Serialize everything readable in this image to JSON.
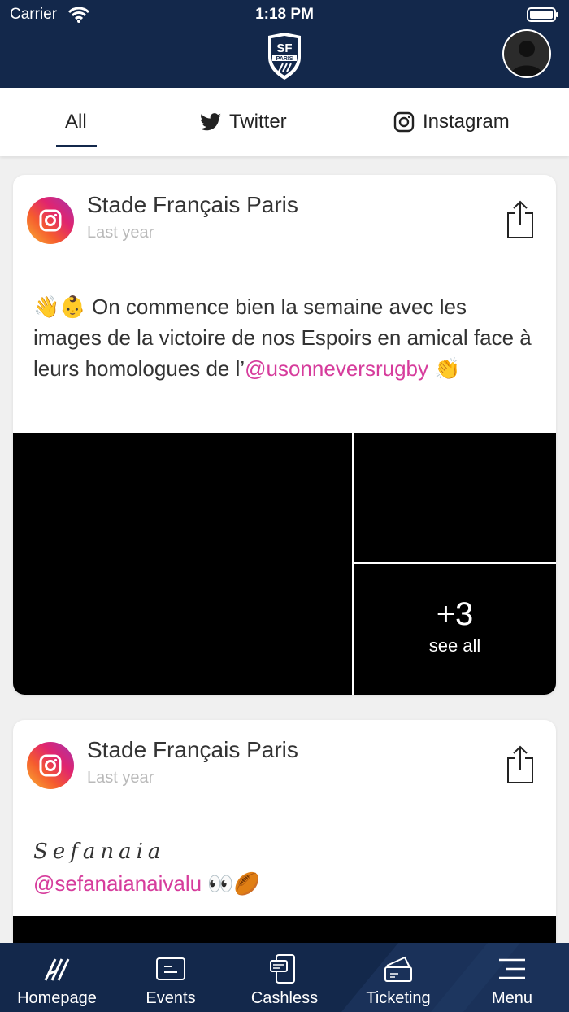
{
  "status_bar": {
    "carrier": "Carrier",
    "time": "1:18 PM"
  },
  "header": {
    "logo_icon": "sf-paris-shield-logo",
    "avatar_icon": "user-avatar-icon"
  },
  "tabs": [
    {
      "label": "All",
      "active": true
    },
    {
      "label": "Twitter",
      "icon": "twitter-icon"
    },
    {
      "label": "Instagram",
      "icon": "instagram-icon"
    }
  ],
  "posts": [
    {
      "source_icon": "instagram-icon",
      "author": "Stade Français Paris",
      "time": "Last year",
      "text_emoji_start": "👋👶",
      "text": " On commence bien la semaine avec les images de la victoire de nos Espoirs en amical face à leurs homologues de l’",
      "mention": "@usonneversrugby",
      "text_emoji_end": " 👏",
      "more_count": "+3",
      "see_all": "see all"
    },
    {
      "source_icon": "instagram-icon",
      "author": "Stade Français Paris",
      "time": "Last year",
      "script_text": "Sefanaia",
      "mention": "@sefanaianaivalu",
      "text_emoji_end": " 👀🏉"
    }
  ],
  "bottom_nav": [
    {
      "label": "Homepage",
      "icon": "claw-marks-icon"
    },
    {
      "label": "Events",
      "icon": "events-card-icon"
    },
    {
      "label": "Cashless",
      "icon": "phone-card-icon"
    },
    {
      "label": "Ticketing",
      "icon": "ticket-icon"
    },
    {
      "label": "Menu",
      "icon": "menu-icon"
    }
  ],
  "colors": {
    "navy": "#13284b",
    "mention": "#d63c9c",
    "muted": "#b9b9b9"
  }
}
